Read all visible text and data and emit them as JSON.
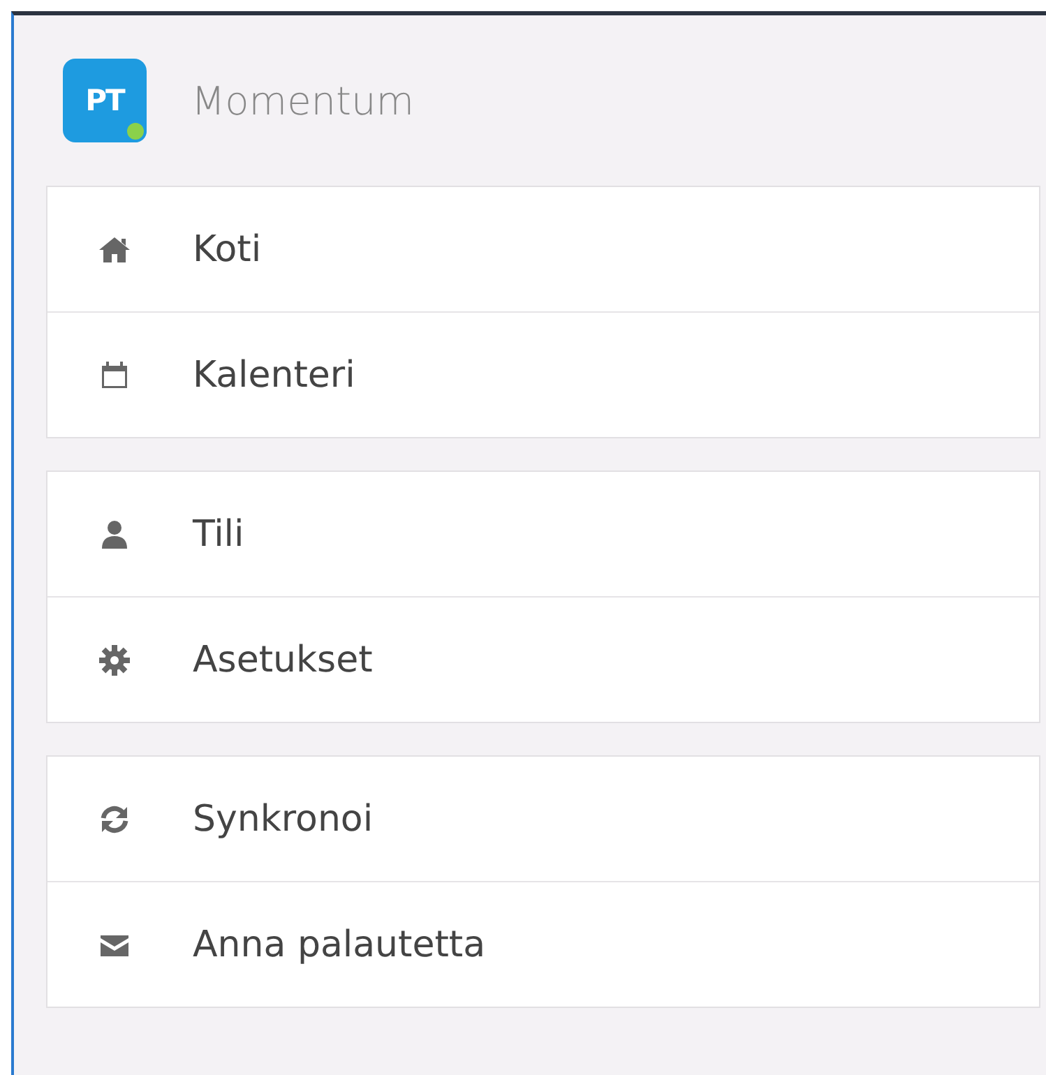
{
  "header": {
    "logo_text": "PT",
    "title": "Momentum"
  },
  "menu_groups": [
    {
      "items": [
        {
          "label": "Koti"
        },
        {
          "label": "Kalenteri"
        }
      ]
    },
    {
      "items": [
        {
          "label": "Tili"
        },
        {
          "label": "Asetukset"
        }
      ]
    },
    {
      "items": [
        {
          "label": "Synkronoi"
        },
        {
          "label": "Anna palautetta"
        }
      ]
    }
  ]
}
